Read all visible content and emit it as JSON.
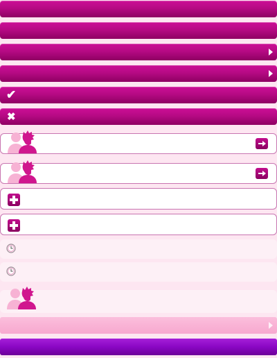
{
  "colors": {
    "magenta_bar": "#b60a84",
    "page_bg": "#fde6f1",
    "row_border": "#c874b0",
    "light_bar": "#f9b4d6",
    "purple_bar": "#8a07c4"
  },
  "icons": {
    "disclosure": "chevron-right-icon",
    "check": "checkmark-icon",
    "close": "x-icon",
    "users": "users-silhouette-icon",
    "forward": "arrow-right-icon",
    "add": "plus-icon",
    "clock": "clock-icon"
  },
  "glyphs": {
    "check": "✔",
    "close": "✖"
  },
  "bars": [
    {
      "label": ""
    },
    {
      "label": ""
    },
    {
      "label": ""
    },
    {
      "label": ""
    },
    {
      "label": ""
    },
    {
      "label": ""
    }
  ],
  "rows": [
    {
      "label": ""
    },
    {
      "label": ""
    },
    {
      "label": ""
    },
    {
      "label": ""
    },
    {
      "label": ""
    },
    {
      "label": ""
    },
    {
      "label": ""
    }
  ]
}
